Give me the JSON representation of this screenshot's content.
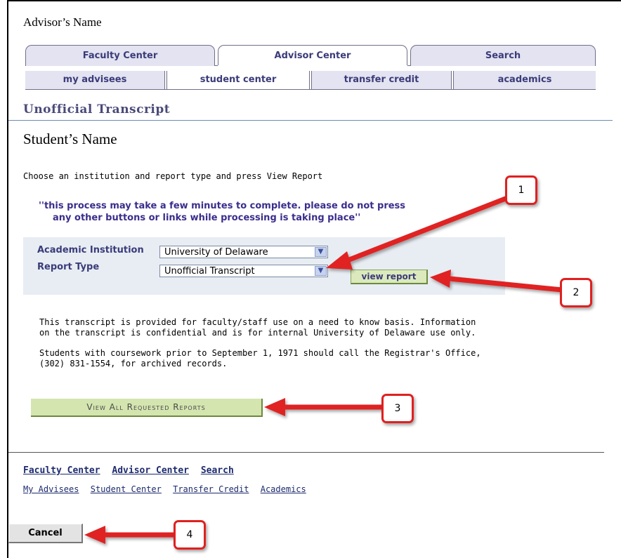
{
  "advisor_name": "Advisor’s Name",
  "tabs": [
    {
      "label": "Faculty Center",
      "active": false
    },
    {
      "label": "Advisor Center",
      "active": true
    },
    {
      "label": "Search",
      "active": false
    }
  ],
  "subtabs": [
    {
      "label": "my advisees",
      "active": false
    },
    {
      "label": "student center",
      "active": true
    },
    {
      "label": "transfer credit",
      "active": false
    },
    {
      "label": "academics",
      "active": false
    }
  ],
  "page_title": "Unofficial Transcript",
  "student_name": "Student’s Name",
  "instruction": "Choose an institution and report type and press View Report",
  "warning": {
    "line1": "''this process may take a few minutes to complete. please do not press",
    "line2": "any other buttons or links while processing is taking place''"
  },
  "form": {
    "institution_label": "Academic Institution",
    "institution_value": "University of Delaware",
    "report_type_label": "Report Type",
    "report_type_value": "Unofficial Transcript",
    "view_report_label": "view report"
  },
  "disclaimer": {
    "para1_line1": "This transcript is provided for faculty/staff  use on a need to know basis.  Information",
    "para1_line2": "on the transcript is confidential and is for internal University of Delaware use only.",
    "para2_line1": "Students with coursework prior to September 1, 1971 should call the Registrar's Office,",
    "para2_line2": "(302) 831-1554,  for archived records."
  },
  "view_all_label": "View All Requested Reports",
  "bottom_links_primary": [
    "Faculty Center",
    "Advisor Center",
    "Search"
  ],
  "bottom_links_secondary": [
    "My Advisees",
    "Student Center",
    "Transfer Credit",
    "Academics"
  ],
  "cancel_label": "Cancel",
  "callouts": [
    "1",
    "2",
    "3",
    "4"
  ],
  "icons": {
    "dropdown": "chevron-down-icon",
    "callout_arrow": "red-arrow-icon"
  },
  "colors": {
    "tab_text": "#3b3b7a",
    "green_button": "#d4e5b0",
    "callout_red": "#e02020",
    "form_bg": "#e8edf3"
  }
}
